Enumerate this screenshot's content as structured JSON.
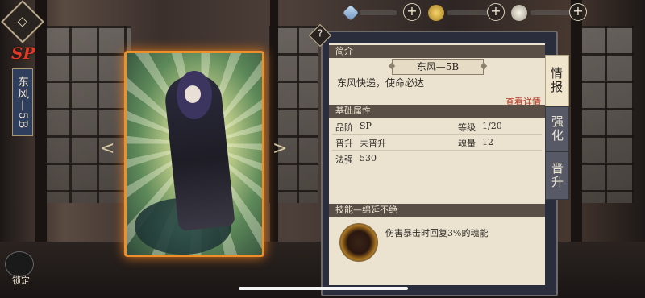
{
  "topbar": {
    "resources": [
      {
        "icon": "crystal-icon",
        "color": "#8fb6d8",
        "plus": "+"
      },
      {
        "icon": "gold-coin-icon",
        "color": "#d9b54a",
        "plus": "+"
      },
      {
        "icon": "rice-bowl-icon",
        "color": "#e8e2d2",
        "plus": "+"
      }
    ]
  },
  "left": {
    "back_glyph": "◇",
    "rarity": "SP",
    "unit_name": "东风—5B",
    "lock_label": "锁定"
  },
  "card": {
    "prev": "<",
    "next": ">"
  },
  "panel": {
    "help": "?",
    "intro_header": "简介",
    "name": "东风—5B",
    "description": "东风快递，使命必达",
    "details_link": "查看详情",
    "attr_header": "基础属性",
    "attrs": {
      "rank_label": "品阶",
      "rank_value": "SP",
      "level_label": "等级",
      "level_value": "1/20",
      "promo_label": "晋升",
      "promo_value": "未晋升",
      "soul_label": "魂量",
      "soul_value": "12",
      "power_label": "法强",
      "power_value": "530"
    },
    "skill_header": "技能—绵延不绝",
    "skill_desc": "伤害暴击时回复3%的魂能"
  },
  "tabs": [
    "情报",
    "强化",
    "晋升"
  ],
  "colors": {
    "accent": "#ef8f2a",
    "rarity": "#e23a27",
    "link": "#b0321f"
  }
}
